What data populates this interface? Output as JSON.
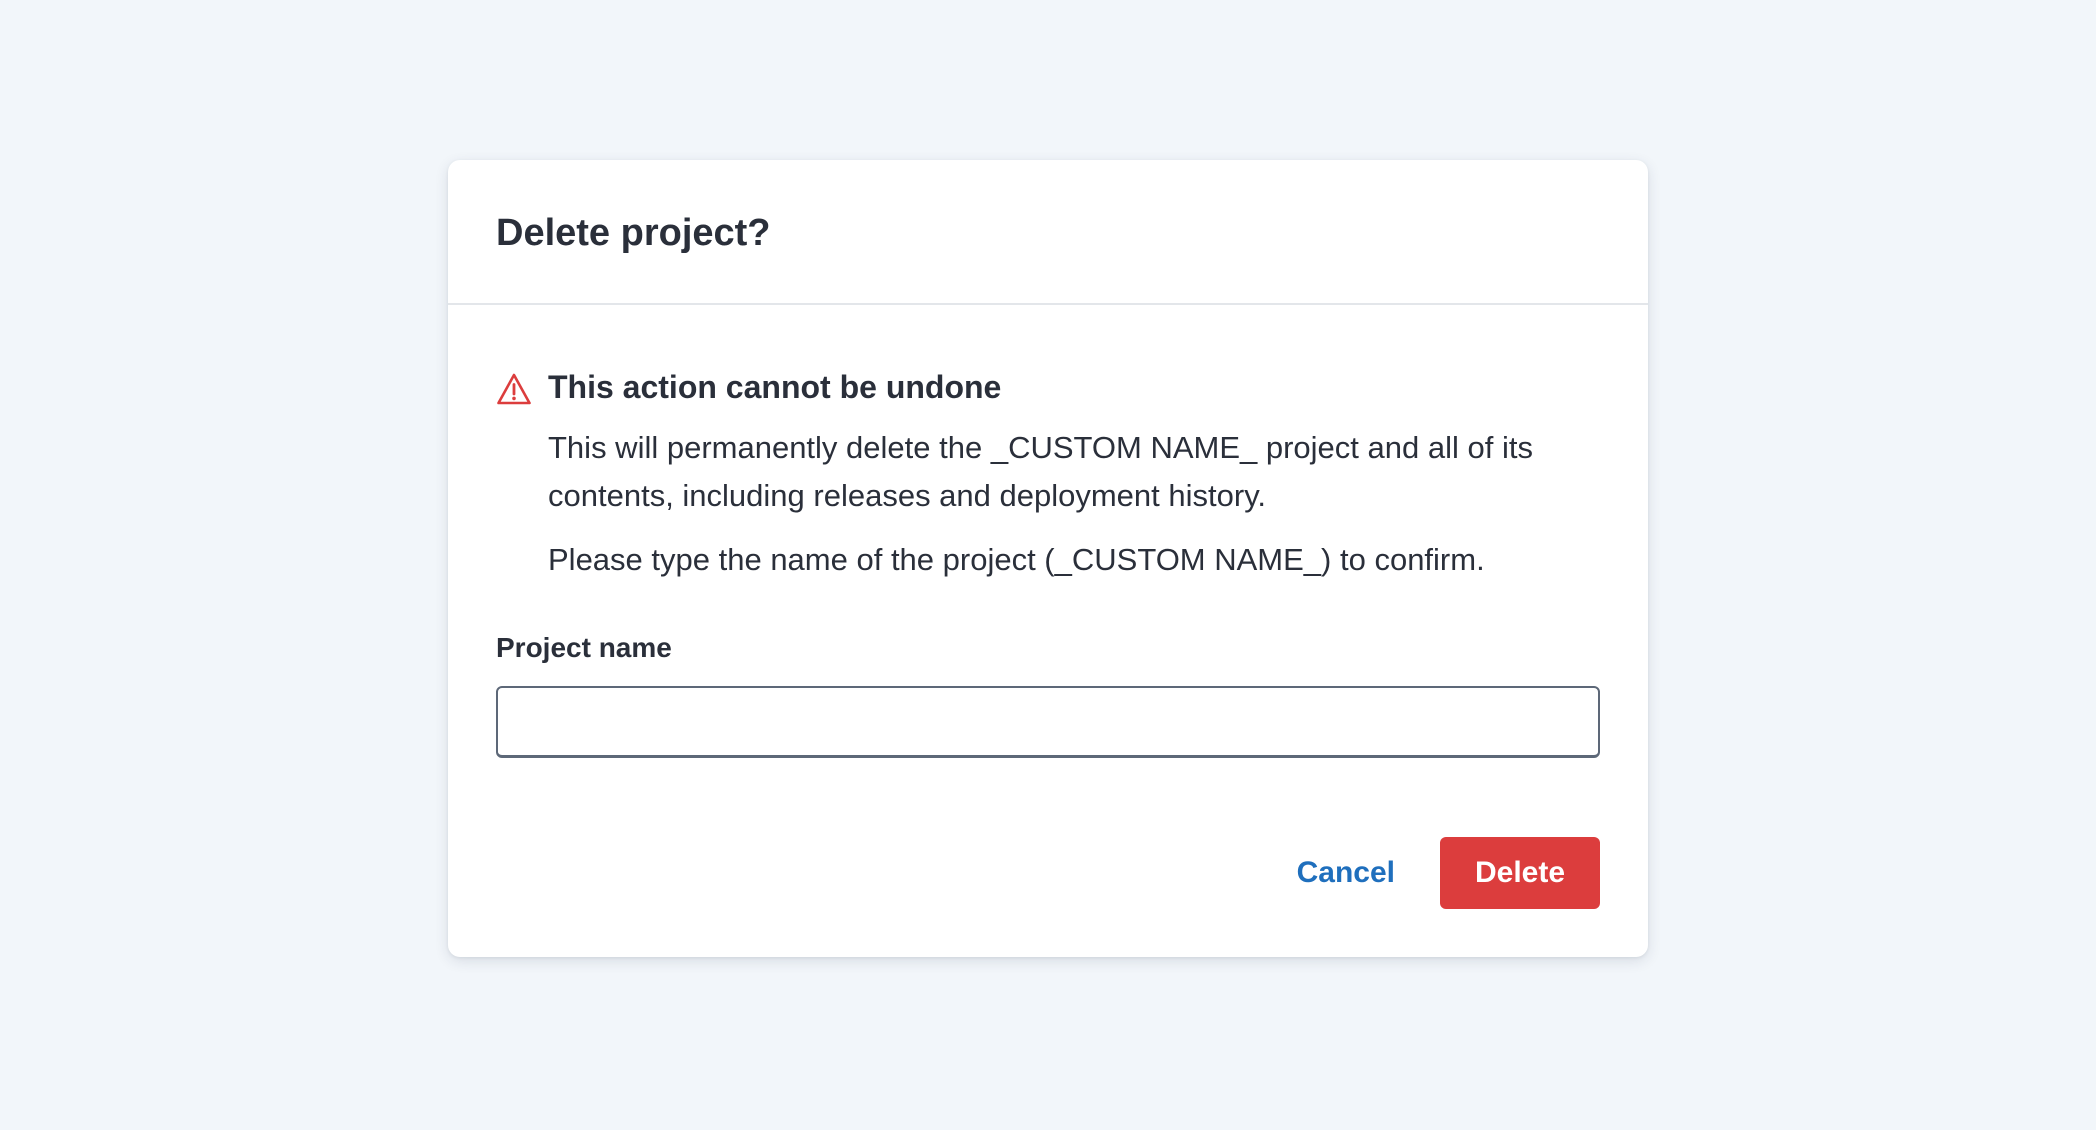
{
  "dialog": {
    "title": "Delete project?",
    "warning": {
      "icon": "warning-triangle-icon",
      "title": "This action cannot be undone",
      "message": "This will permanently delete the _CUSTOM NAME_ project and all of its contents, including releases and deployment history.",
      "confirm_instruction": "Please type the name of the project (_CUSTOM NAME_) to confirm."
    },
    "field": {
      "label": "Project name",
      "value": "",
      "placeholder": ""
    },
    "actions": {
      "cancel_label": "Cancel",
      "delete_label": "Delete"
    }
  },
  "colors": {
    "background": "#f2f6fa",
    "danger": "#dc3d3d",
    "link": "#1f6fbd",
    "text": "#2a2f3a"
  }
}
